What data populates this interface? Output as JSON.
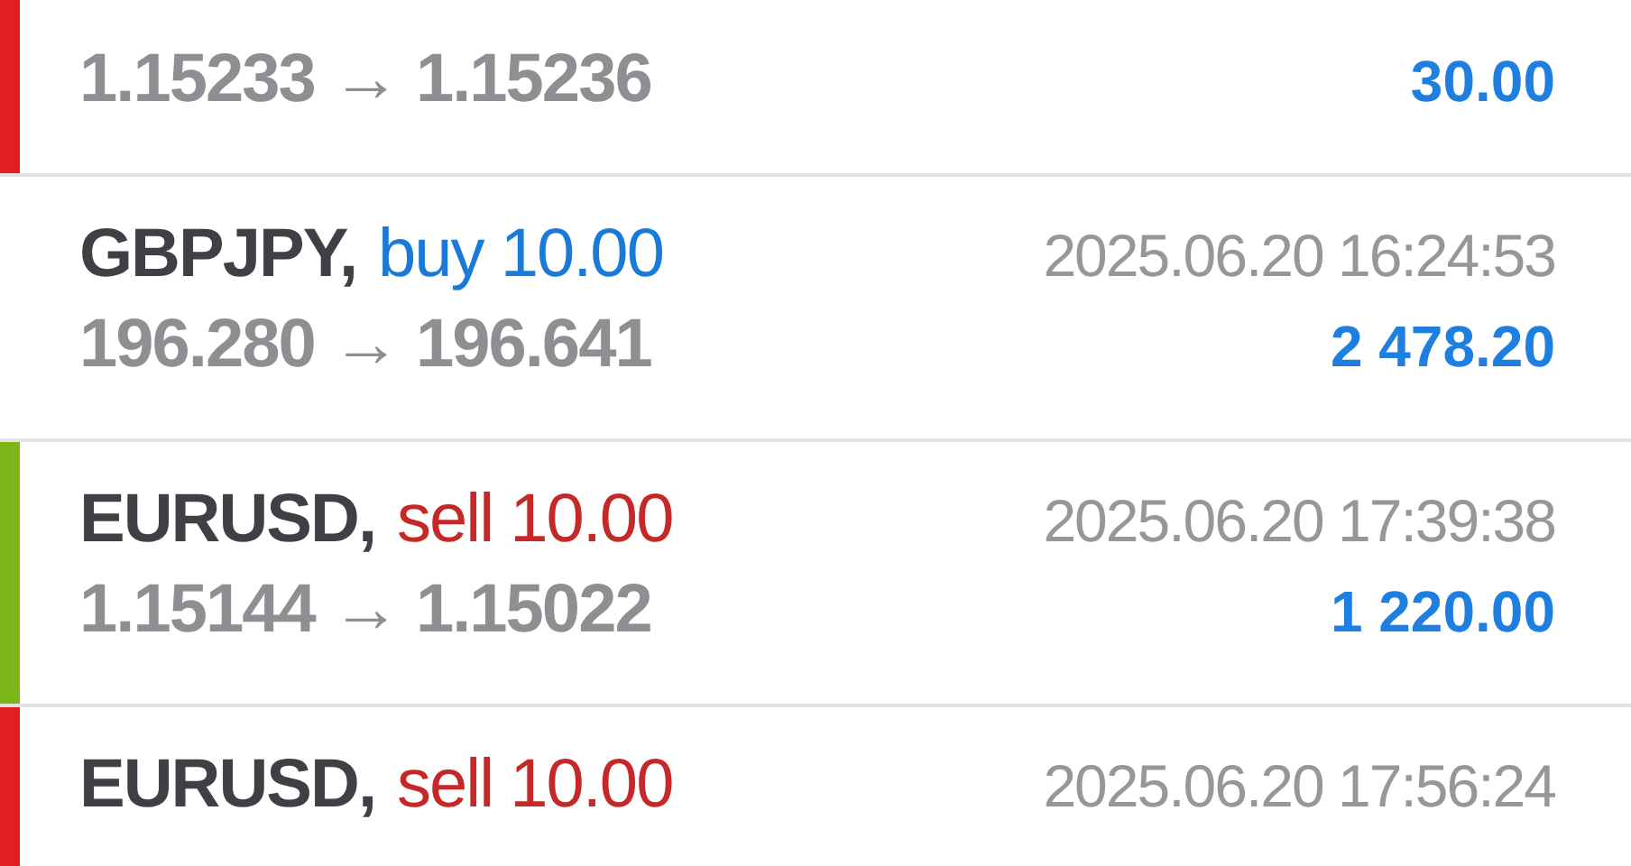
{
  "trades": [
    {
      "prices": "1.15233 → 1.15236",
      "profit": "30.00",
      "color": "#e02020"
    },
    {
      "symbol": "GBPJPY,",
      "kind": "buy",
      "action": "buy 10.00",
      "time": "2025.06.20 16:24:53",
      "prices": "196.280 → 196.641",
      "profit": "2 478.20"
    },
    {
      "symbol": "EURUSD,",
      "kind": "sell",
      "action": "sell 10.00",
      "time": "2025.06.20 17:39:38",
      "prices": "1.15144 → 1.15022",
      "profit": "1 220.00",
      "color": "#7cb518"
    },
    {
      "symbol": "EURUSD,",
      "kind": "sell",
      "action": "sell 10.00",
      "time": "2025.06.20 17:56:24",
      "color": "#e02020"
    }
  ]
}
